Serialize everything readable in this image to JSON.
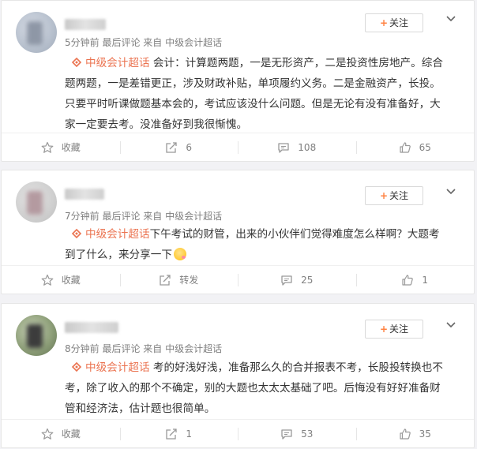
{
  "posts": [
    {
      "meta": "5分钟前  最后评论  来自 中级会计超话",
      "follow_label": "关注",
      "topic": "中级会计超话",
      "lines": [
        "会计：计算题两题，一是无形资产，二是投资性房地产。综合",
        "题两题，一是差错更正，涉及财政补贴，单项履约义务。二是金融资产，长投。",
        "只要平时听课做题基本会的，考试应该没什么问题。但是无论有没有准备好，大",
        "家一定要去考。没准备好到我很惭愧。"
      ],
      "actions": {
        "favorite": "收藏",
        "repost": "6",
        "comment": "108",
        "like": "65"
      }
    },
    {
      "meta": "7分钟前  最后评论  来自 中级会计超话",
      "follow_label": "关注",
      "topic": "中级会计超话",
      "lines": [
        "下午考试的财管，出来的小伙伴们觉得难度怎么样啊？大题考",
        "到了什么，来分享一下"
      ],
      "actions": {
        "favorite": "收藏",
        "repost": "转发",
        "comment": "25",
        "like": "1"
      }
    },
    {
      "meta": "8分钟前  最后评论  来自 中级会计超话",
      "follow_label": "关注",
      "topic": "中级会计超话",
      "lines": [
        "考的好浅好浅，准备那么久的合并报表不考，长股投转换也不",
        "考，除了收入的那个不确定，别的大题也太太太基础了吧。后悔没有好好准备财",
        "管和经济法，估计题也很简单。"
      ],
      "actions": {
        "favorite": "收藏",
        "repost": "1",
        "comment": "53",
        "like": "35"
      }
    }
  ],
  "icons": {
    "topic": "diamond-topic-icon",
    "favorite": "star-icon",
    "repost": "repost-icon",
    "comment": "comment-icon",
    "like": "thumbs-up-icon",
    "menu": "chevron-down-icon"
  },
  "colors": {
    "accent": "#eb7350",
    "follow_plus": "#ff8140",
    "meta": "#808080"
  }
}
